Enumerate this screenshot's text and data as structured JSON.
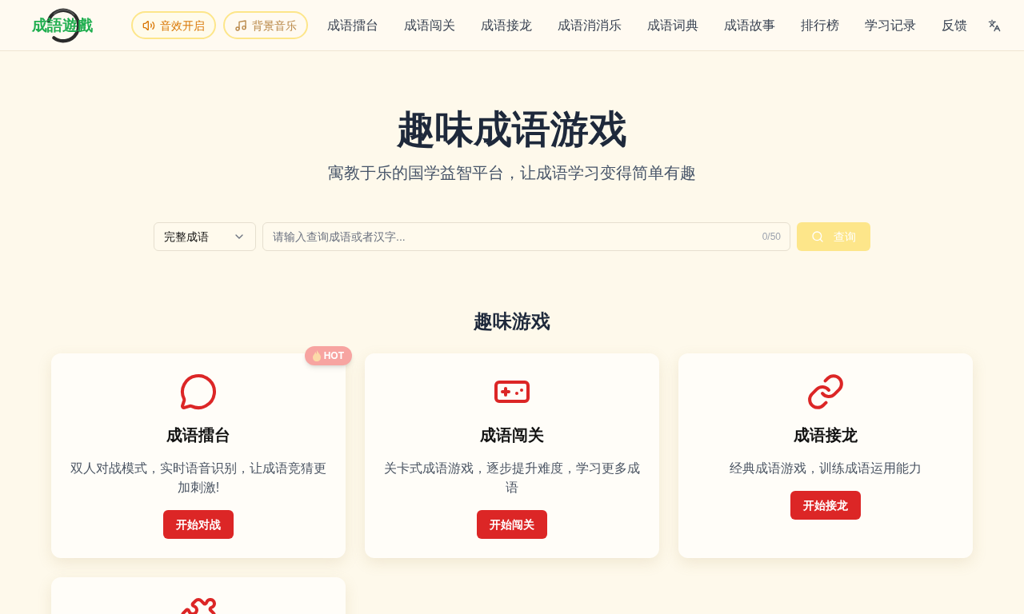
{
  "header": {
    "logo": {
      "text": "成語遊戲"
    },
    "sound_buttons": [
      {
        "kind": "sound",
        "label": "音效开启",
        "on": true
      },
      {
        "kind": "music",
        "label": "背景音乐",
        "on": false
      }
    ],
    "nav": [
      "成语擂台",
      "成语闯关",
      "成语接龙",
      "成语消消乐",
      "成语词典",
      "成语故事",
      "排行榜",
      "学习记录",
      "反馈"
    ]
  },
  "hero": {
    "title": "趣味成语游戏",
    "subtitle": "寓教于乐的国学益智平台，让成语学习变得简单有趣"
  },
  "search": {
    "mode": "完整成语",
    "placeholder": "请输入查询成语或者汉字...",
    "counter": "0/50",
    "button": {
      "label": "查询",
      "disabled": true
    }
  },
  "games": {
    "title": "趣味游戏",
    "hot_label": "HOT",
    "cards": [
      {
        "title": "成语擂台",
        "description": "双人对战模式，实时语音识别，让成语竞猜更加刺激!",
        "button": "开始对战",
        "hot": true
      },
      {
        "title": "成语闯关",
        "description": "关卡式成语游戏，逐步提升难度，学习更多成语",
        "button": "开始闯关",
        "hot": false
      },
      {
        "title": "成语接龙",
        "description": "经典成语游戏，训练成语运用能力",
        "button": "开始接龙",
        "hot": false
      },
      {
        "hot": false
      }
    ]
  }
}
